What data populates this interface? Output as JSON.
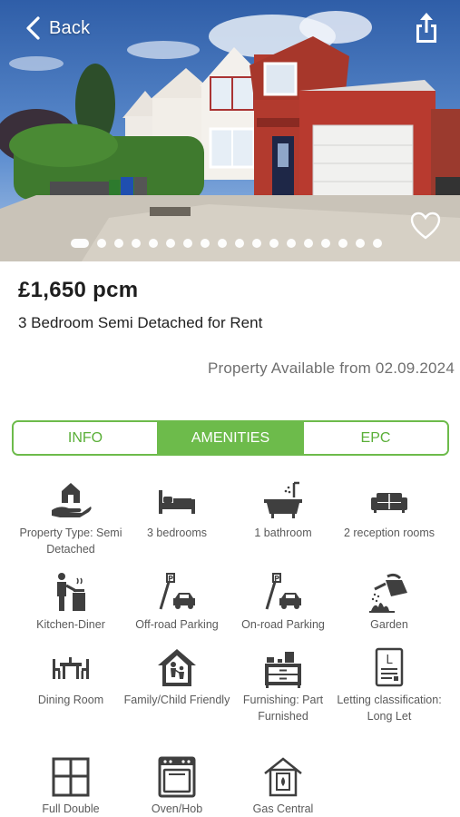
{
  "header": {
    "back_label": "Back"
  },
  "gallery": {
    "photo_count": 18,
    "active_index": 0
  },
  "listing": {
    "price": "£1,650 pcm",
    "title": "3 Bedroom Semi Detached for Rent",
    "availability": "Property Available from 02.09.2024"
  },
  "tabs": [
    {
      "label": "INFO",
      "active": false
    },
    {
      "label": "AMENITIES",
      "active": true
    },
    {
      "label": "EPC",
      "active": false
    }
  ],
  "amenities": [
    {
      "icon": "house-hand-icon",
      "label": "Property Type: Semi Detached"
    },
    {
      "icon": "bed-icon",
      "label": "3 bedrooms"
    },
    {
      "icon": "bathtub-icon",
      "label": "1 bathroom"
    },
    {
      "icon": "sofa-icon",
      "label": "2 reception rooms"
    },
    {
      "icon": "kitchen-icon",
      "label": "Kitchen-Diner"
    },
    {
      "icon": "parking-icon",
      "label": "Off-road Parking"
    },
    {
      "icon": "parking-icon",
      "label": "On-road Parking"
    },
    {
      "icon": "watering-can-icon",
      "label": "Garden"
    },
    {
      "icon": "dining-table-icon",
      "label": "Dining Room"
    },
    {
      "icon": "family-house-icon",
      "label": "Family/Child Friendly"
    },
    {
      "icon": "furniture-icon",
      "label": "Furnishing: Part Furnished"
    },
    {
      "icon": "document-icon",
      "label": "Letting classification: Long Let"
    },
    {
      "icon": "window-icon",
      "label": "Full Double"
    },
    {
      "icon": "oven-icon",
      "label": "Oven/Hob"
    },
    {
      "icon": "boiler-house-icon",
      "label": "Gas Central"
    }
  ],
  "colors": {
    "accent": "#6dbb4b",
    "accent_text": "#5aaf38",
    "icon": "#3f3f3f",
    "muted_text": "#6f6f6f"
  }
}
